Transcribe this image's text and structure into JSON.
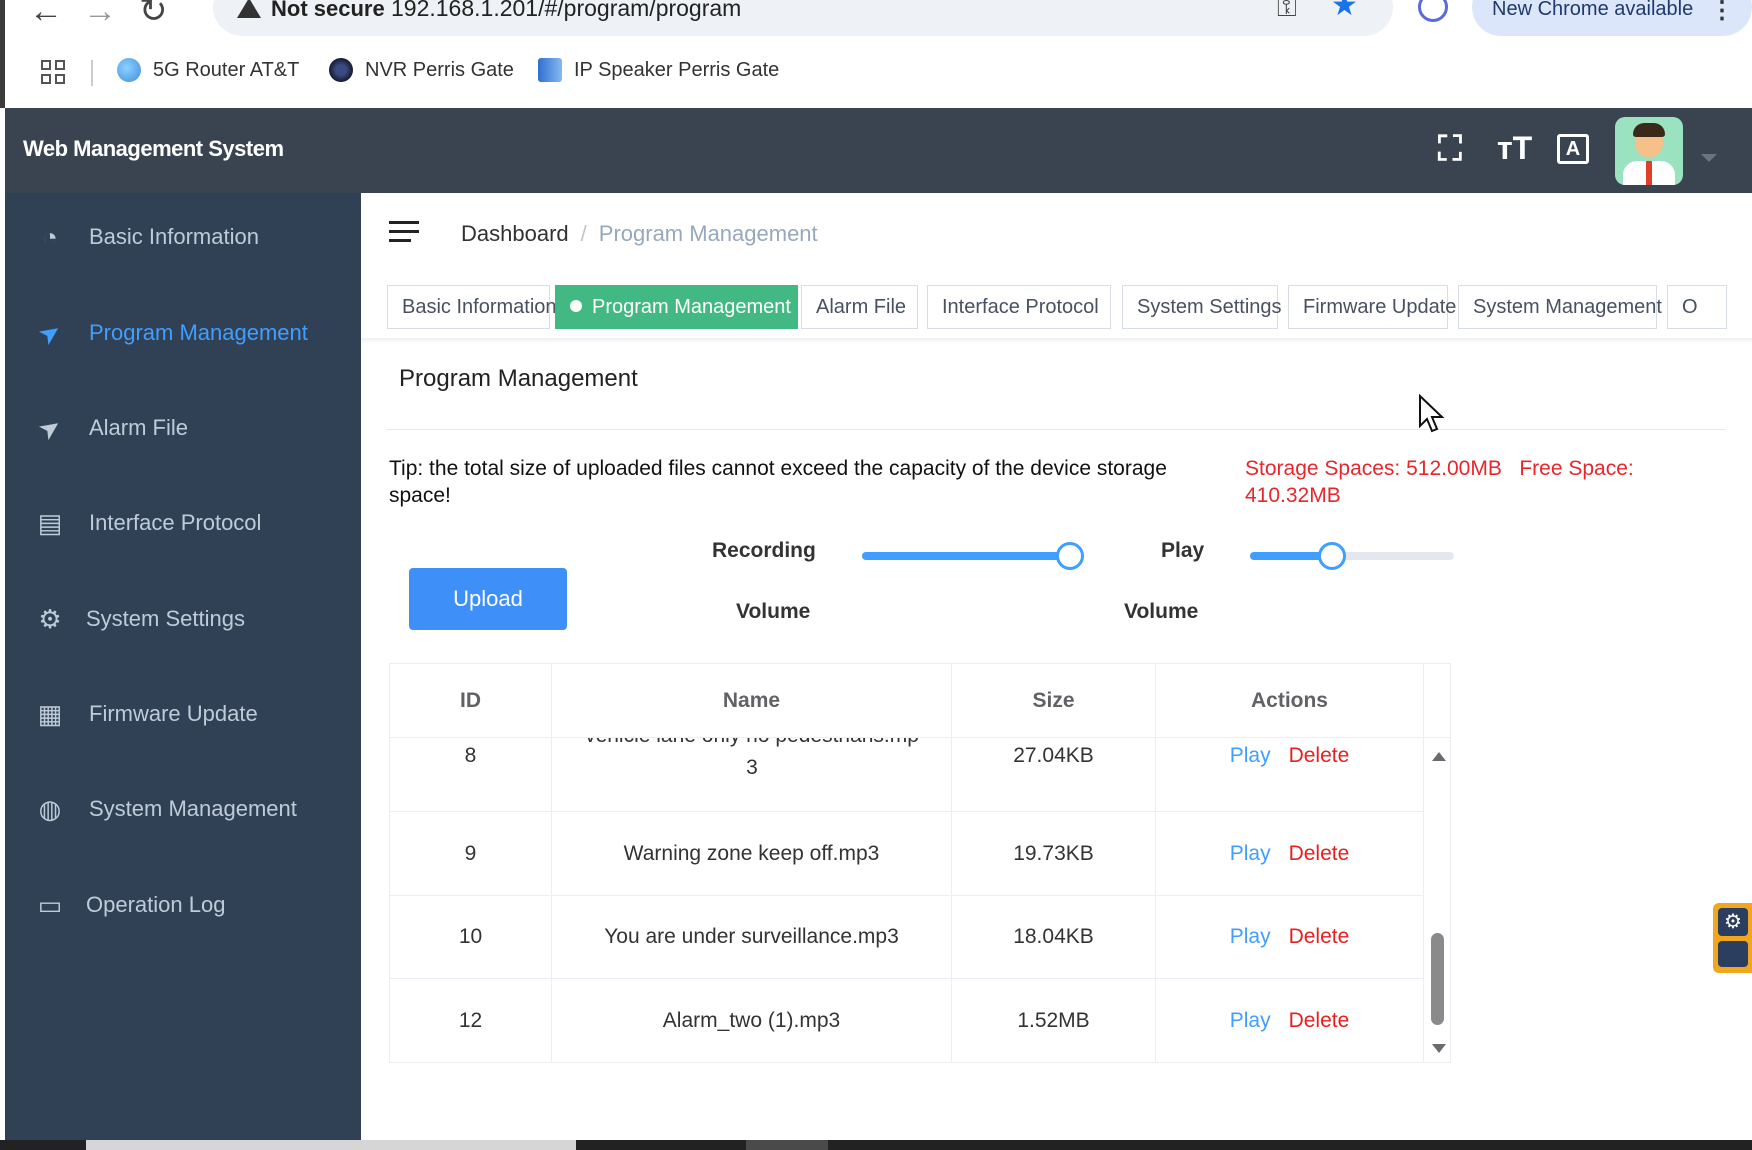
{
  "browser": {
    "nav": {
      "back": "←",
      "forward": "→",
      "reload": "↻"
    },
    "security_label": "Not secure",
    "url": "192.168.1.201/#/program/program",
    "new_chrome_label": "New Chrome available",
    "bookmarks": [
      {
        "label": "5G Router AT&T",
        "icon": "globe-icon",
        "color": "#3d8fe0"
      },
      {
        "label": "NVR Perris Gate",
        "icon": "camera-icon",
        "color": "#1f2b50"
      },
      {
        "label": "IP Speaker Perris Gate",
        "icon": "megaphone-icon",
        "color": "#4a83d8"
      }
    ]
  },
  "header": {
    "title": "Web Management System",
    "icons": [
      "fullscreen-icon",
      "font-size-icon",
      "translate-icon"
    ],
    "icon_glyphs": {
      "fullscreen": "⛶",
      "font_size": "тT",
      "translate": "A"
    }
  },
  "sidebar": {
    "items": [
      {
        "label": "Basic Information",
        "icon": "dashboard-icon",
        "glyph": "◔",
        "active": false
      },
      {
        "label": "Program Management",
        "icon": "paper-plane-icon",
        "glyph": "➤",
        "active": true
      },
      {
        "label": "Alarm File",
        "icon": "paper-plane-icon",
        "glyph": "➤",
        "active": false
      },
      {
        "label": "Interface Protocol",
        "icon": "document-icon",
        "glyph": "▤",
        "active": false
      },
      {
        "label": "System Settings",
        "icon": "gear-icon",
        "glyph": "⚙",
        "active": false
      },
      {
        "label": "Firmware Update",
        "icon": "grid-icon",
        "glyph": "▦",
        "active": false
      },
      {
        "label": "System Management",
        "icon": "globe-icon",
        "glyph": "◍",
        "active": false
      },
      {
        "label": "Operation Log",
        "icon": "file-icon",
        "glyph": "▭",
        "active": false
      }
    ]
  },
  "breadcrumb": {
    "root": "Dashboard",
    "separator": "/",
    "current": "Program Management"
  },
  "tabs": [
    {
      "label": "Basic Information",
      "active": false
    },
    {
      "label": "Program Management",
      "active": true
    },
    {
      "label": "Alarm File",
      "active": false
    },
    {
      "label": "Interface Protocol",
      "active": false
    },
    {
      "label": "System Settings",
      "active": false
    },
    {
      "label": "Firmware Update",
      "active": false
    },
    {
      "label": "System Management",
      "active": false
    },
    {
      "label": "O",
      "active": false
    }
  ],
  "main": {
    "title": "Program Management",
    "tip": "Tip: the total size of uploaded files cannot exceed the capacity of the device storage space!",
    "storage_label": "Storage Spaces: 512.00MB",
    "free_space_label": "Free Space: 410.32MB",
    "upload_label": "Upload",
    "recording_label": "Recording",
    "recording_volume_label": "Volume",
    "recording_volume_fraction": 0.99,
    "play_label": "Play",
    "play_volume_label": "Volume",
    "play_volume_fraction": 0.4
  },
  "table": {
    "columns": [
      "ID",
      "Name",
      "Size",
      "Actions"
    ],
    "rows": [
      {
        "id": "8",
        "name": "vehicle lane only no pedestrians.mp",
        "name_cont": "3",
        "size": "27.04KB",
        "play": "Play",
        "delete": "Delete"
      },
      {
        "id": "9",
        "name": "Warning zone keep off.mp3",
        "size": "19.73KB",
        "play": "Play",
        "delete": "Delete"
      },
      {
        "id": "10",
        "name": "You are under surveillance.mp3",
        "size": "18.04KB",
        "play": "Play",
        "delete": "Delete"
      },
      {
        "id": "12",
        "name": "Alarm_two (1).mp3",
        "size": "1.52MB",
        "play": "Play",
        "delete": "Delete"
      }
    ]
  },
  "colors": {
    "sidebar_bg": "#304156",
    "header_bg": "#3a4350",
    "active_blue": "#409eff",
    "active_tag_green": "#42b983",
    "danger_red": "#e62020"
  }
}
